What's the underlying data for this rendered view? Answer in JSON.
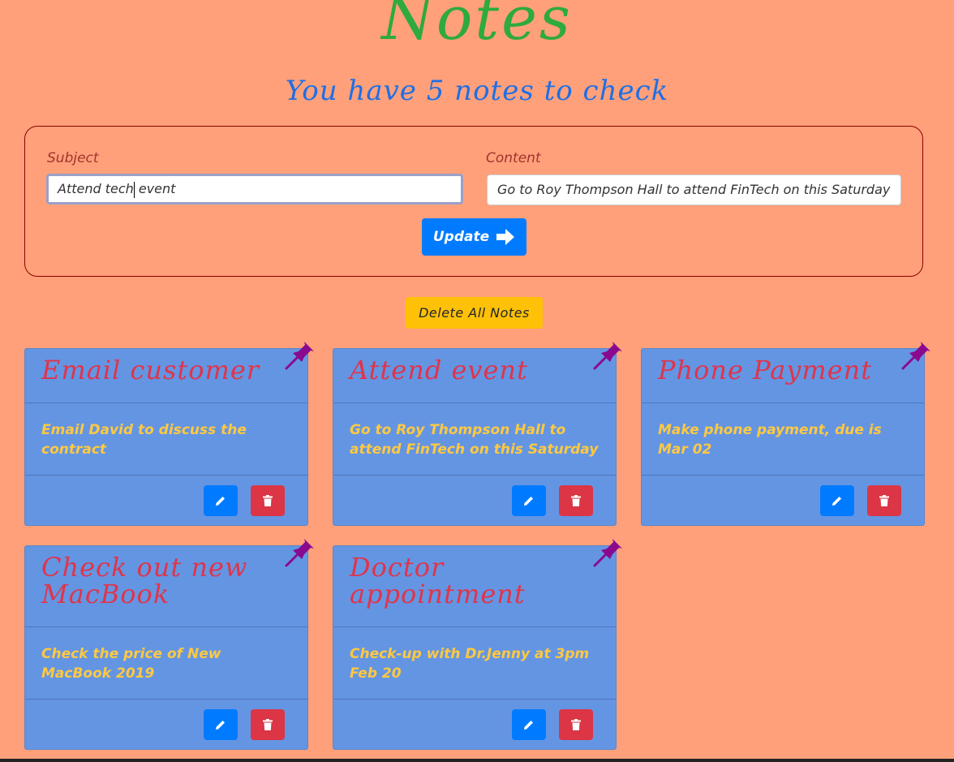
{
  "header": {
    "title": "Notes",
    "subtitle": "You have 5 notes to check"
  },
  "form": {
    "subject_label": "Subject",
    "subject_value": "Attend tech event",
    "content_label": "Content",
    "content_value": "Go to Roy Thompson Hall to attend FinTech on this Saturday",
    "update_label": "Update"
  },
  "delete_all_label": "Delete All Notes",
  "notes": [
    {
      "title": "Email customer",
      "content": "Email David to discuss the contract"
    },
    {
      "title": "Attend event",
      "content": "Go to Roy Thompson Hall to attend FinTech on this Saturday"
    },
    {
      "title": "Phone Payment",
      "content": "Make phone payment, due is Mar 02"
    },
    {
      "title": "Check out new MacBook",
      "content": "Check the price of New MacBook 2019"
    },
    {
      "title": "Doctor appointment",
      "content": "Check-up with Dr.Jenny at 3pm Feb 20"
    }
  ],
  "colors": {
    "background": "#ffa07a",
    "title": "#2eaa3e",
    "subtitle": "#1e6fe6",
    "card": "#6495e3",
    "note_title": "#e0344a",
    "note_content": "#ffc940",
    "pin": "#8a0a8f"
  },
  "icons": {
    "update": "arrow-right-icon",
    "edit": "pencil-icon",
    "delete": "trash-icon",
    "pin": "pushpin-icon"
  }
}
